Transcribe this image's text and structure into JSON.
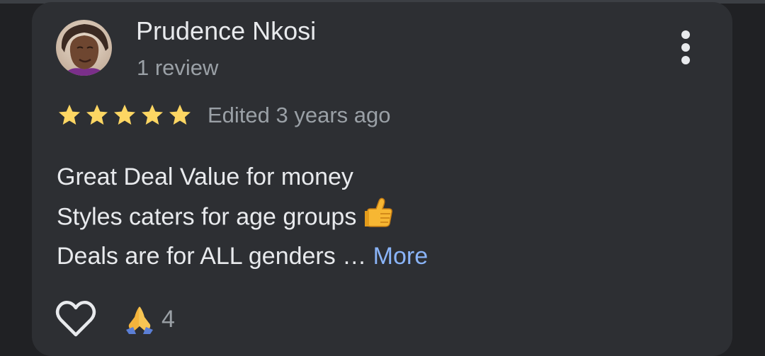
{
  "review": {
    "author_name": "Prudence Nkosi",
    "author_review_count": "1 review",
    "rating": 5,
    "rating_max": 5,
    "timestamp": "Edited 3 years ago",
    "text_lines": [
      "Great Deal Value for money",
      "Styles caters for age groups",
      "Deals are for ALL genders …"
    ],
    "more_label": "More",
    "reaction_count": "4"
  },
  "colors": {
    "background": "#202124",
    "card": "#2d2f33",
    "primary_text": "#e8eaed",
    "secondary_text": "#9aa0a6",
    "star": "#fdd663",
    "link": "#8ab4f8"
  },
  "icons": {
    "overflow_menu": "three-dots-vertical-icon",
    "like": "heart-outline-icon",
    "reaction": "folded-hands-icon",
    "inline_emoji": "thumbs-up-icon"
  }
}
